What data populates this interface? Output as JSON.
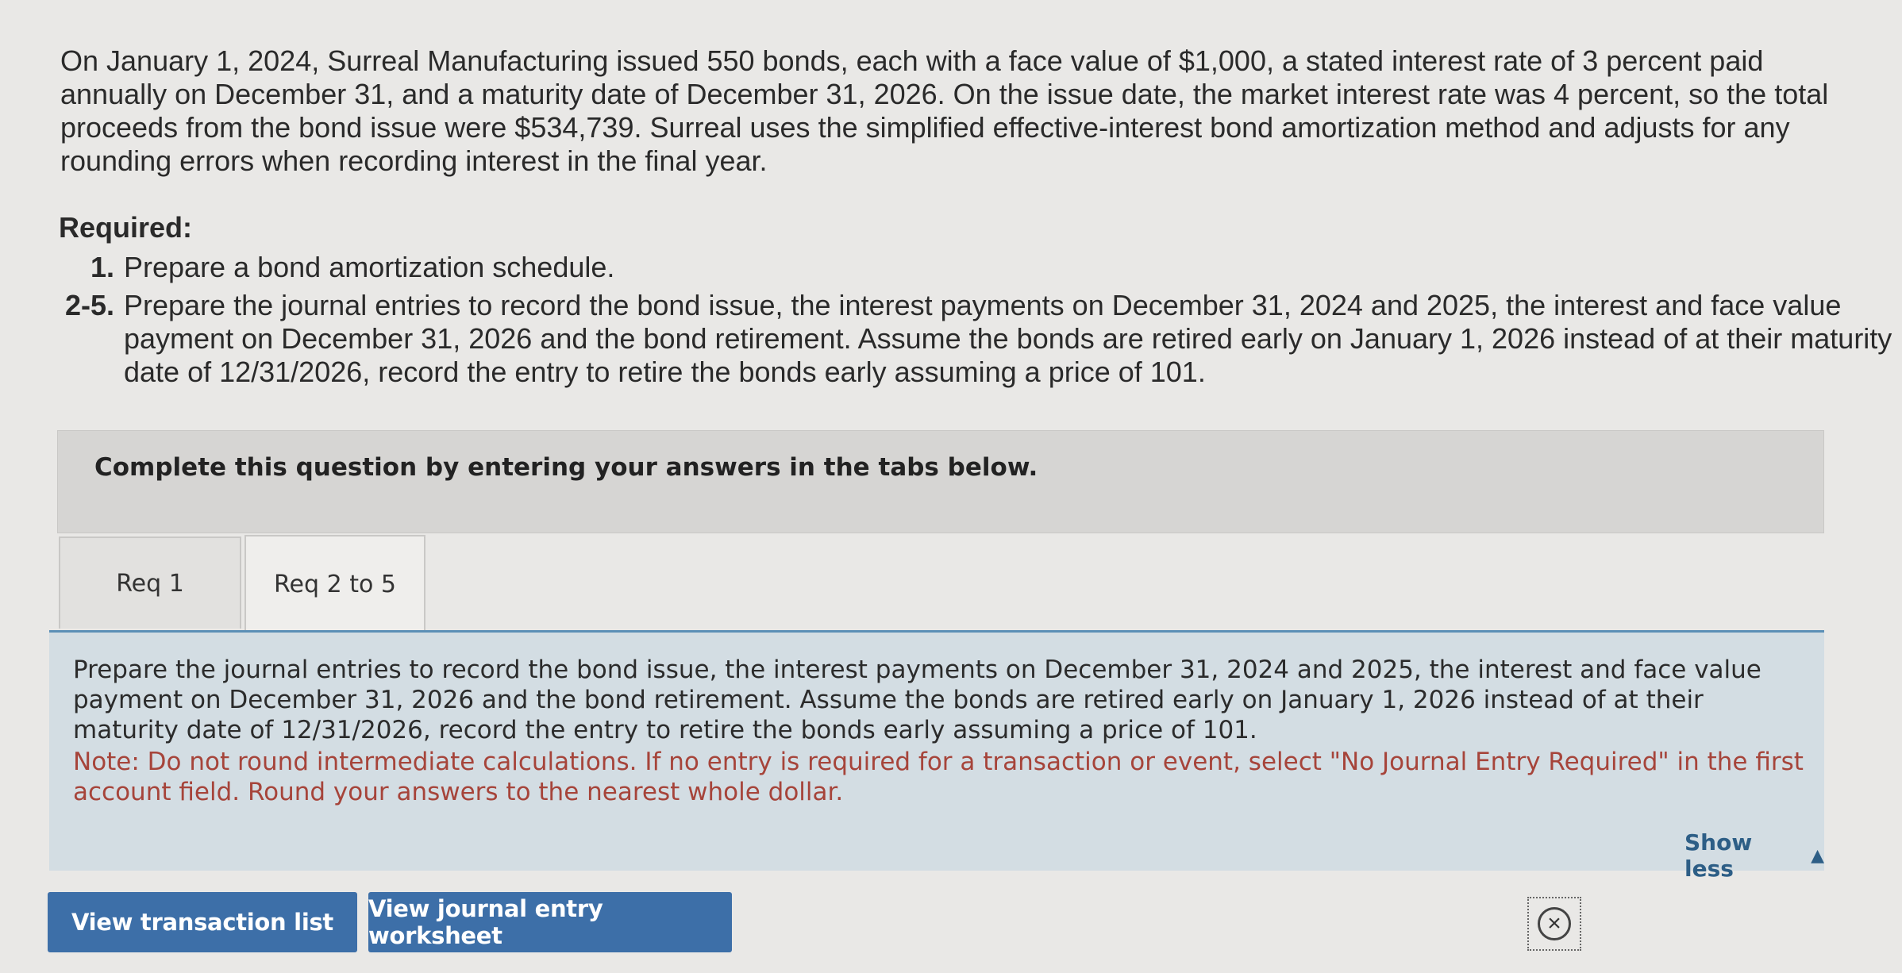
{
  "problem": {
    "text": "On January 1, 2024, Surreal Manufacturing issued 550 bonds, each with a face value of $1,000, a stated interest rate of 3 percent paid annually on December 31, and a maturity date of December 31, 2026. On the issue date, the market interest rate was 4 percent, so the total proceeds from the bond issue were $534,739. Surreal uses the simplified effective-interest bond amortization method and adjusts for any rounding errors when recording interest in the final year."
  },
  "required": {
    "heading": "Required:",
    "items": [
      {
        "num": "1.",
        "text": "Prepare a bond amortization schedule."
      },
      {
        "num": "2-5.",
        "text": "Prepare the journal entries to record the bond issue, the interest payments on December 31, 2024 and 2025, the interest and face value payment on December 31, 2026 and the bond retirement. Assume the bonds are retired early on January 1, 2026 instead of at their maturity date of 12/31/2026, record the entry to retire the bonds early assuming a price of 101."
      }
    ]
  },
  "instruction": "Complete this question by entering your answers in the tabs below.",
  "tabs": [
    {
      "label": "Req 1"
    },
    {
      "label": "Req 2 to 5"
    }
  ],
  "panel": {
    "description": "Prepare the journal entries to record the bond issue, the interest payments on December 31, 2024 and 2025, the interest and face value payment on December 31, 2026 and the bond retirement. Assume the bonds are retired early on January 1, 2026 instead of at their maturity date of 12/31/2026, record the entry to retire the bonds early assuming a price of 101.",
    "note": "Note: Do not round intermediate calculations. If no entry is required for a transaction or event, select \"No Journal Entry Required\" in the first account field. Round your answers to the nearest whole dollar.",
    "show_less": "Show less"
  },
  "buttons": {
    "transaction_list": "View transaction list",
    "journal_worksheet": "View journal entry worksheet"
  },
  "icons": {
    "close": "close-icon",
    "triangle": "triangle-up-icon"
  },
  "colors": {
    "button_bg": "#3d6fa8",
    "note_text": "#a6443a",
    "panel_bg": "#d3dde3",
    "link": "#2d5e86"
  }
}
